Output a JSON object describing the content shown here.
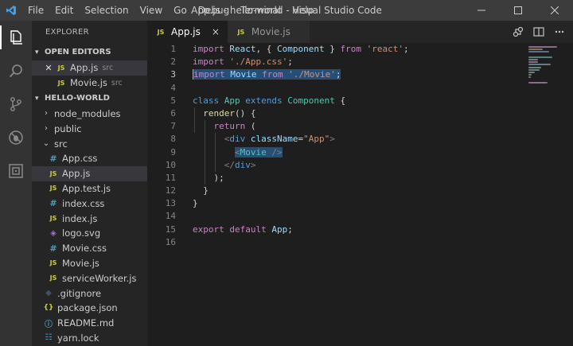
{
  "window": {
    "title": "App.js - hello-world - Visual Studio Code",
    "menu": [
      "File",
      "Edit",
      "Selection",
      "View",
      "Go",
      "Debug",
      "Terminal",
      "Help"
    ]
  },
  "activity_bar": [
    {
      "name": "explorer-icon",
      "active": true
    },
    {
      "name": "search-icon",
      "active": false
    },
    {
      "name": "source-control-icon",
      "active": false
    },
    {
      "name": "debug-icon",
      "active": false
    },
    {
      "name": "extensions-icon",
      "active": false
    }
  ],
  "sidebar": {
    "title": "EXPLORER",
    "open_editors": {
      "label": "OPEN EDITORS",
      "items": [
        {
          "icon": "JS",
          "label": "App.js",
          "hint": "src",
          "closable": true
        },
        {
          "icon": "JS",
          "label": "Movie.js",
          "hint": "src",
          "closable": false
        }
      ]
    },
    "project": {
      "label": "HELLO-WORLD",
      "items": [
        {
          "type": "folder",
          "label": "node_modules",
          "expanded": false,
          "depth": 1
        },
        {
          "type": "folder",
          "label": "public",
          "expanded": false,
          "depth": 1
        },
        {
          "type": "folder",
          "label": "src",
          "expanded": true,
          "depth": 1
        },
        {
          "type": "css",
          "icon": "#",
          "label": "App.css",
          "depth": 2
        },
        {
          "type": "js",
          "icon": "JS",
          "label": "App.js",
          "depth": 2,
          "selected": true
        },
        {
          "type": "js",
          "icon": "JS",
          "label": "App.test.js",
          "depth": 2
        },
        {
          "type": "css",
          "icon": "#",
          "label": "index.css",
          "depth": 2
        },
        {
          "type": "js",
          "icon": "JS",
          "label": "index.js",
          "depth": 2
        },
        {
          "type": "svg",
          "icon": "◈",
          "label": "logo.svg",
          "depth": 2
        },
        {
          "type": "css",
          "icon": "#",
          "label": "Movie.css",
          "depth": 2
        },
        {
          "type": "js",
          "icon": "JS",
          "label": "Movie.js",
          "depth": 2
        },
        {
          "type": "js",
          "icon": "JS",
          "label": "serviceWorker.js",
          "depth": 2
        },
        {
          "type": "git",
          "icon": "◆",
          "label": ".gitignore",
          "depth": 1
        },
        {
          "type": "json",
          "icon": "{}",
          "label": "package.json",
          "depth": 1
        },
        {
          "type": "info",
          "icon": "ⓘ",
          "label": "README.md",
          "depth": 1
        },
        {
          "type": "yarn",
          "icon": "☷",
          "label": "yarn.lock",
          "depth": 1
        }
      ]
    }
  },
  "tabs": [
    {
      "icon": "JS",
      "label": "App.js",
      "active": true,
      "close": "×"
    },
    {
      "icon": "JS",
      "label": "Movie.js",
      "active": false,
      "close": ""
    }
  ],
  "editor": {
    "current_line": 3,
    "lines": [
      {
        "n": "1",
        "tokens": [
          [
            "kc",
            "import"
          ],
          [
            "p",
            " "
          ],
          [
            "v",
            "React"
          ],
          [
            "p",
            ", { "
          ],
          [
            "v",
            "Component"
          ],
          [
            "p",
            " } "
          ],
          [
            "kc",
            "from"
          ],
          [
            "p",
            " "
          ],
          [
            "s",
            "'react'"
          ],
          [
            "p",
            ";"
          ]
        ]
      },
      {
        "n": "2",
        "tokens": [
          [
            "kc",
            "import"
          ],
          [
            "p",
            " "
          ],
          [
            "s",
            "'./App.css'"
          ],
          [
            "p",
            ";"
          ]
        ]
      },
      {
        "n": "3",
        "selected": true,
        "tokens": [
          [
            "kc",
            "import"
          ],
          [
            "p",
            " "
          ],
          [
            "v",
            "Movie"
          ],
          [
            "p",
            " "
          ],
          [
            "kc",
            "from"
          ],
          [
            "p",
            " "
          ],
          [
            "s",
            "'./Movie'"
          ],
          [
            "p",
            ";"
          ]
        ]
      },
      {
        "n": "4",
        "tokens": []
      },
      {
        "n": "5",
        "tokens": [
          [
            "k",
            "class"
          ],
          [
            "p",
            " "
          ],
          [
            "cls",
            "App"
          ],
          [
            "p",
            " "
          ],
          [
            "k",
            "extends"
          ],
          [
            "p",
            " "
          ],
          [
            "cls",
            "Component"
          ],
          [
            "p",
            " {"
          ]
        ]
      },
      {
        "n": "6",
        "tokens": [
          [
            "p",
            "  "
          ],
          [
            "f",
            "render"
          ],
          [
            "p",
            "() {"
          ]
        ]
      },
      {
        "n": "7",
        "tokens": [
          [
            "p",
            "    "
          ],
          [
            "kc",
            "return"
          ],
          [
            "p",
            " ("
          ]
        ]
      },
      {
        "n": "8",
        "tokens": [
          [
            "p",
            "      "
          ],
          [
            "tg",
            "<"
          ],
          [
            "tag",
            "div"
          ],
          [
            "p",
            " "
          ],
          [
            "attr",
            "className"
          ],
          [
            "p",
            "="
          ],
          [
            "s",
            "\"App\""
          ],
          [
            "tg",
            ">"
          ]
        ]
      },
      {
        "n": "9",
        "tokens": [
          [
            "p",
            "        "
          ],
          [
            "tg",
            "<"
          ],
          [
            "cls",
            "Movie"
          ],
          [
            "p",
            " "
          ],
          [
            "tg",
            "/>"
          ]
        ],
        "sel_from": 1
      },
      {
        "n": "10",
        "tokens": [
          [
            "p",
            "      "
          ],
          [
            "tg",
            "</"
          ],
          [
            "tag",
            "div"
          ],
          [
            "tg",
            ">"
          ]
        ]
      },
      {
        "n": "11",
        "tokens": [
          [
            "p",
            "    );"
          ]
        ]
      },
      {
        "n": "12",
        "tokens": [
          [
            "p",
            "  }"
          ]
        ]
      },
      {
        "n": "13",
        "tokens": [
          [
            "p",
            "}"
          ]
        ]
      },
      {
        "n": "14",
        "tokens": []
      },
      {
        "n": "15",
        "tokens": [
          [
            "kc",
            "export"
          ],
          [
            "p",
            " "
          ],
          [
            "kc",
            "default"
          ],
          [
            "p",
            " "
          ],
          [
            "v",
            "App"
          ],
          [
            "p",
            ";"
          ]
        ]
      },
      {
        "n": "16",
        "tokens": []
      }
    ]
  },
  "colors": {
    "accent": "#007acc",
    "selection": "#264f78",
    "js_icon": "#cbcb41",
    "css_icon": "#519aba"
  }
}
